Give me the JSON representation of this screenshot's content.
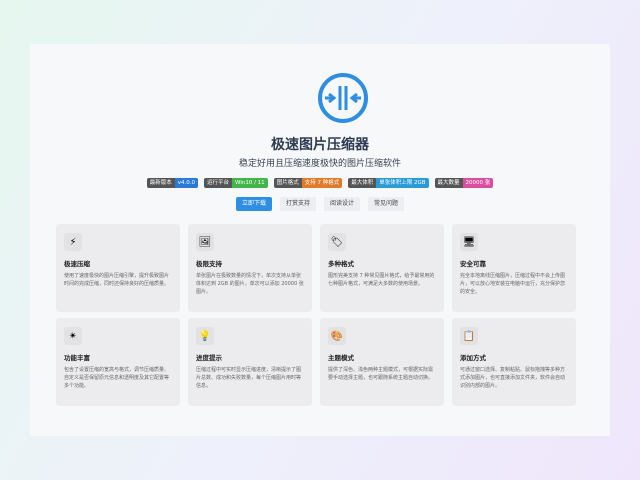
{
  "app": {
    "title": "极速图片压缩器",
    "subtitle": "稳定好用且压缩速度极快的图片压缩软件"
  },
  "colors": {
    "accent": "#2e8ee3",
    "logo_ring": "#2e8ee3"
  },
  "badges": [
    {
      "key": "最新版本",
      "value": "v4.0.0",
      "color": "#2b7bd6"
    },
    {
      "key": "运行平台",
      "value": "Win10 / 11",
      "color": "#44b54a"
    },
    {
      "key": "图片格式",
      "value": "支持 7 种格式",
      "color": "#e07b2a"
    },
    {
      "key": "最大体积",
      "value": "单张体积上限 2GB",
      "color": "#2a9bd6"
    },
    {
      "key": "最大数量",
      "value": "20000 张",
      "color": "#d94fa0"
    }
  ],
  "buttons": [
    {
      "label": "立即下载",
      "primary": true
    },
    {
      "label": "打赏支持",
      "primary": false
    },
    {
      "label": "阅读设计",
      "primary": false
    },
    {
      "label": "常见问题",
      "primary": false
    }
  ],
  "features": [
    {
      "icon": "lightning-icon",
      "glyph": "⚡",
      "title": "极速压缩",
      "desc": "使用了速度极快的图片压缩引擎，提升极致图片时间的完成压缩，同时还保持良好的压缩质量。"
    },
    {
      "icon": "image-icon",
      "glyph": "🖼",
      "title": "极限支持",
      "desc": "单张图片在极致数量的情况下，单次支持从单张体积达到 2GB 的图片，单次可以添加 20000 张图片。"
    },
    {
      "icon": "tag-icon",
      "glyph": "🏷",
      "title": "多种格式",
      "desc": "图形完美支持 7 种常见图片格式，给予最常用的七种图片格式，可满足大多数的使用场景。"
    },
    {
      "icon": "monitor-icon",
      "glyph": "🖥",
      "title": "安全可靠",
      "desc": "完全本地离线压缩图片，压缩过程中不会上传图片，可以放心地安装在电脑中运行，充分保护您的安全。"
    },
    {
      "icon": "star-icon",
      "glyph": "✴",
      "title": "功能丰富",
      "desc": "包含了设置压缩的宽高与格式，调节压缩质量、自定义是否保留原元信息和透明度及其它配置等多个功能。"
    },
    {
      "icon": "bulb-icon",
      "glyph": "💡",
      "title": "进度提示",
      "desc": "压缩过程中可实时显示压缩进度，清晰提示了图片总数、成功和失败数量，每个压缩图片用时等信息。"
    },
    {
      "icon": "palette-icon",
      "glyph": "🎨",
      "title": "主题模式",
      "desc": "提供了深色、浅色两种主题模式，可根据实际需要手动选择主题，也可跟随系统主题自动切换。"
    },
    {
      "icon": "clipboard-icon",
      "glyph": "📋",
      "title": "添加方式",
      "desc": "可通过窗口选择、复制粘贴、鼠标拖拽等多种方式添加图片，也可直接添加文件夹，软件会自动识别内部的图片。"
    }
  ]
}
